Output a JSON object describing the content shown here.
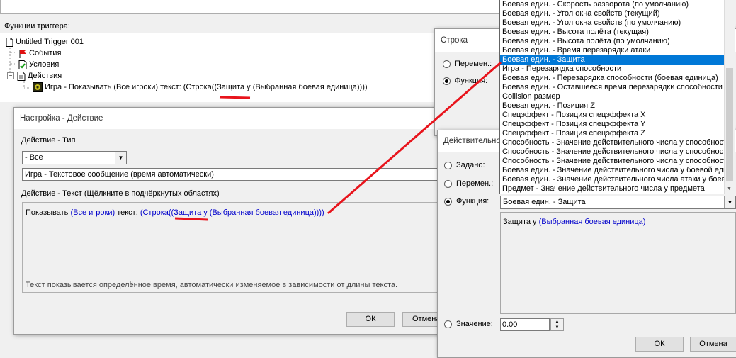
{
  "main": {
    "functions_header": "Функции триггера:",
    "tree": {
      "root": "Untitled Trigger 001",
      "events": "События",
      "conditions": "Условия",
      "actions": "Действия",
      "action_item": "Игра - Показывать (Все игроки) текст: (Строка((Защита у (Выбранная боевая единица))))"
    }
  },
  "setup_dialog": {
    "title": "Настройка -  Действие",
    "action_type_label": "Действие  - Тип",
    "type_combo": "- Все",
    "action_list_value": "Игра - Текстовое сообщение (время автоматически)",
    "text_label": "Действие  - Текст (Щёлкните в подчёркнутых областях)",
    "text_prefix": "Показывать",
    "link_players": "(Все игроки)",
    "text_mid": "текст:",
    "link_string": "(Строка((Защита у (Выбранная боевая единица))))",
    "description": "Текст показывается определённое время, автоматически изменяемое в зависимости от длины текста.",
    "ok": "ОК",
    "cancel": "Отмена"
  },
  "string_dialog": {
    "title": "Строка",
    "radio_var": "Перемен.:",
    "radio_func": "Функция:"
  },
  "real_dialog": {
    "title": "Действительно",
    "radio_given": "Задано:",
    "radio_var": "Перемен.:",
    "radio_func": "Функция:",
    "func_value": "Боевая един. - Защита",
    "preview_prefix": "Защита у",
    "preview_link": "(Выбранная боевая единица)",
    "radio_value": "Значение:",
    "value_input": "0.00",
    "ok": "ОК",
    "cancel": "Отмена"
  },
  "dropdown": {
    "items": [
      "Боевая един. - Скорость разворота (по умолчанию)",
      "Боевая един. - Угол окна свойств (текущий)",
      "Боевая един. - Угол окна свойств (по умолчанию)",
      "Боевая един. - Высота полёта (текущая)",
      "Боевая един. - Высота полёта (по умолчанию)",
      "Боевая един. - Время перезарядки атаки",
      "Боевая един. - Защита",
      "Игра - Перезарядка способности",
      "Боевая един. - Перезарядка способности (боевая единица)",
      "Боевая един. - Оставшееся время перезарядки способности",
      "Collision размер",
      "Боевая един. - Позиция Z",
      "Спецэффект - Позиция спецэффекта X",
      "Спецэффект - Позиция спецэффекта Y",
      "Спецэффект - Позиция спецэффекта Z",
      "Способность - Значение действительного числа у способности",
      "Способность - Значение действительного числа у способности",
      "Способность - Значение действительного числа у способности",
      "Боевая един. - Значение действительного числа у боевой единицы",
      "Боевая един. - Значение действительного числа атаки у боевой единицы",
      "Предмет - Значение действительного числа у предмета"
    ],
    "selected_index": 6
  },
  "colors": {
    "annotation": "#e8141c",
    "selection": "#0078d7",
    "link": "#0000cc"
  }
}
